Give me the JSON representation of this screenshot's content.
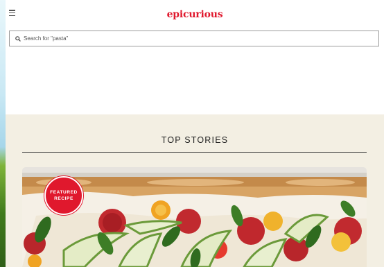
{
  "header": {
    "logo": "epicurious"
  },
  "search": {
    "placeholder": "Search for \"pasta\"",
    "value": ""
  },
  "top_stories": {
    "title": "TOP STORIES",
    "featured_card": {
      "badge": "FEATURED RECIPE"
    }
  },
  "colors": {
    "brand_red": "#e0182d",
    "stories_bg": "#f3efe3"
  },
  "icons": {
    "menu": "hamburger-menu-icon",
    "search": "search-icon"
  }
}
